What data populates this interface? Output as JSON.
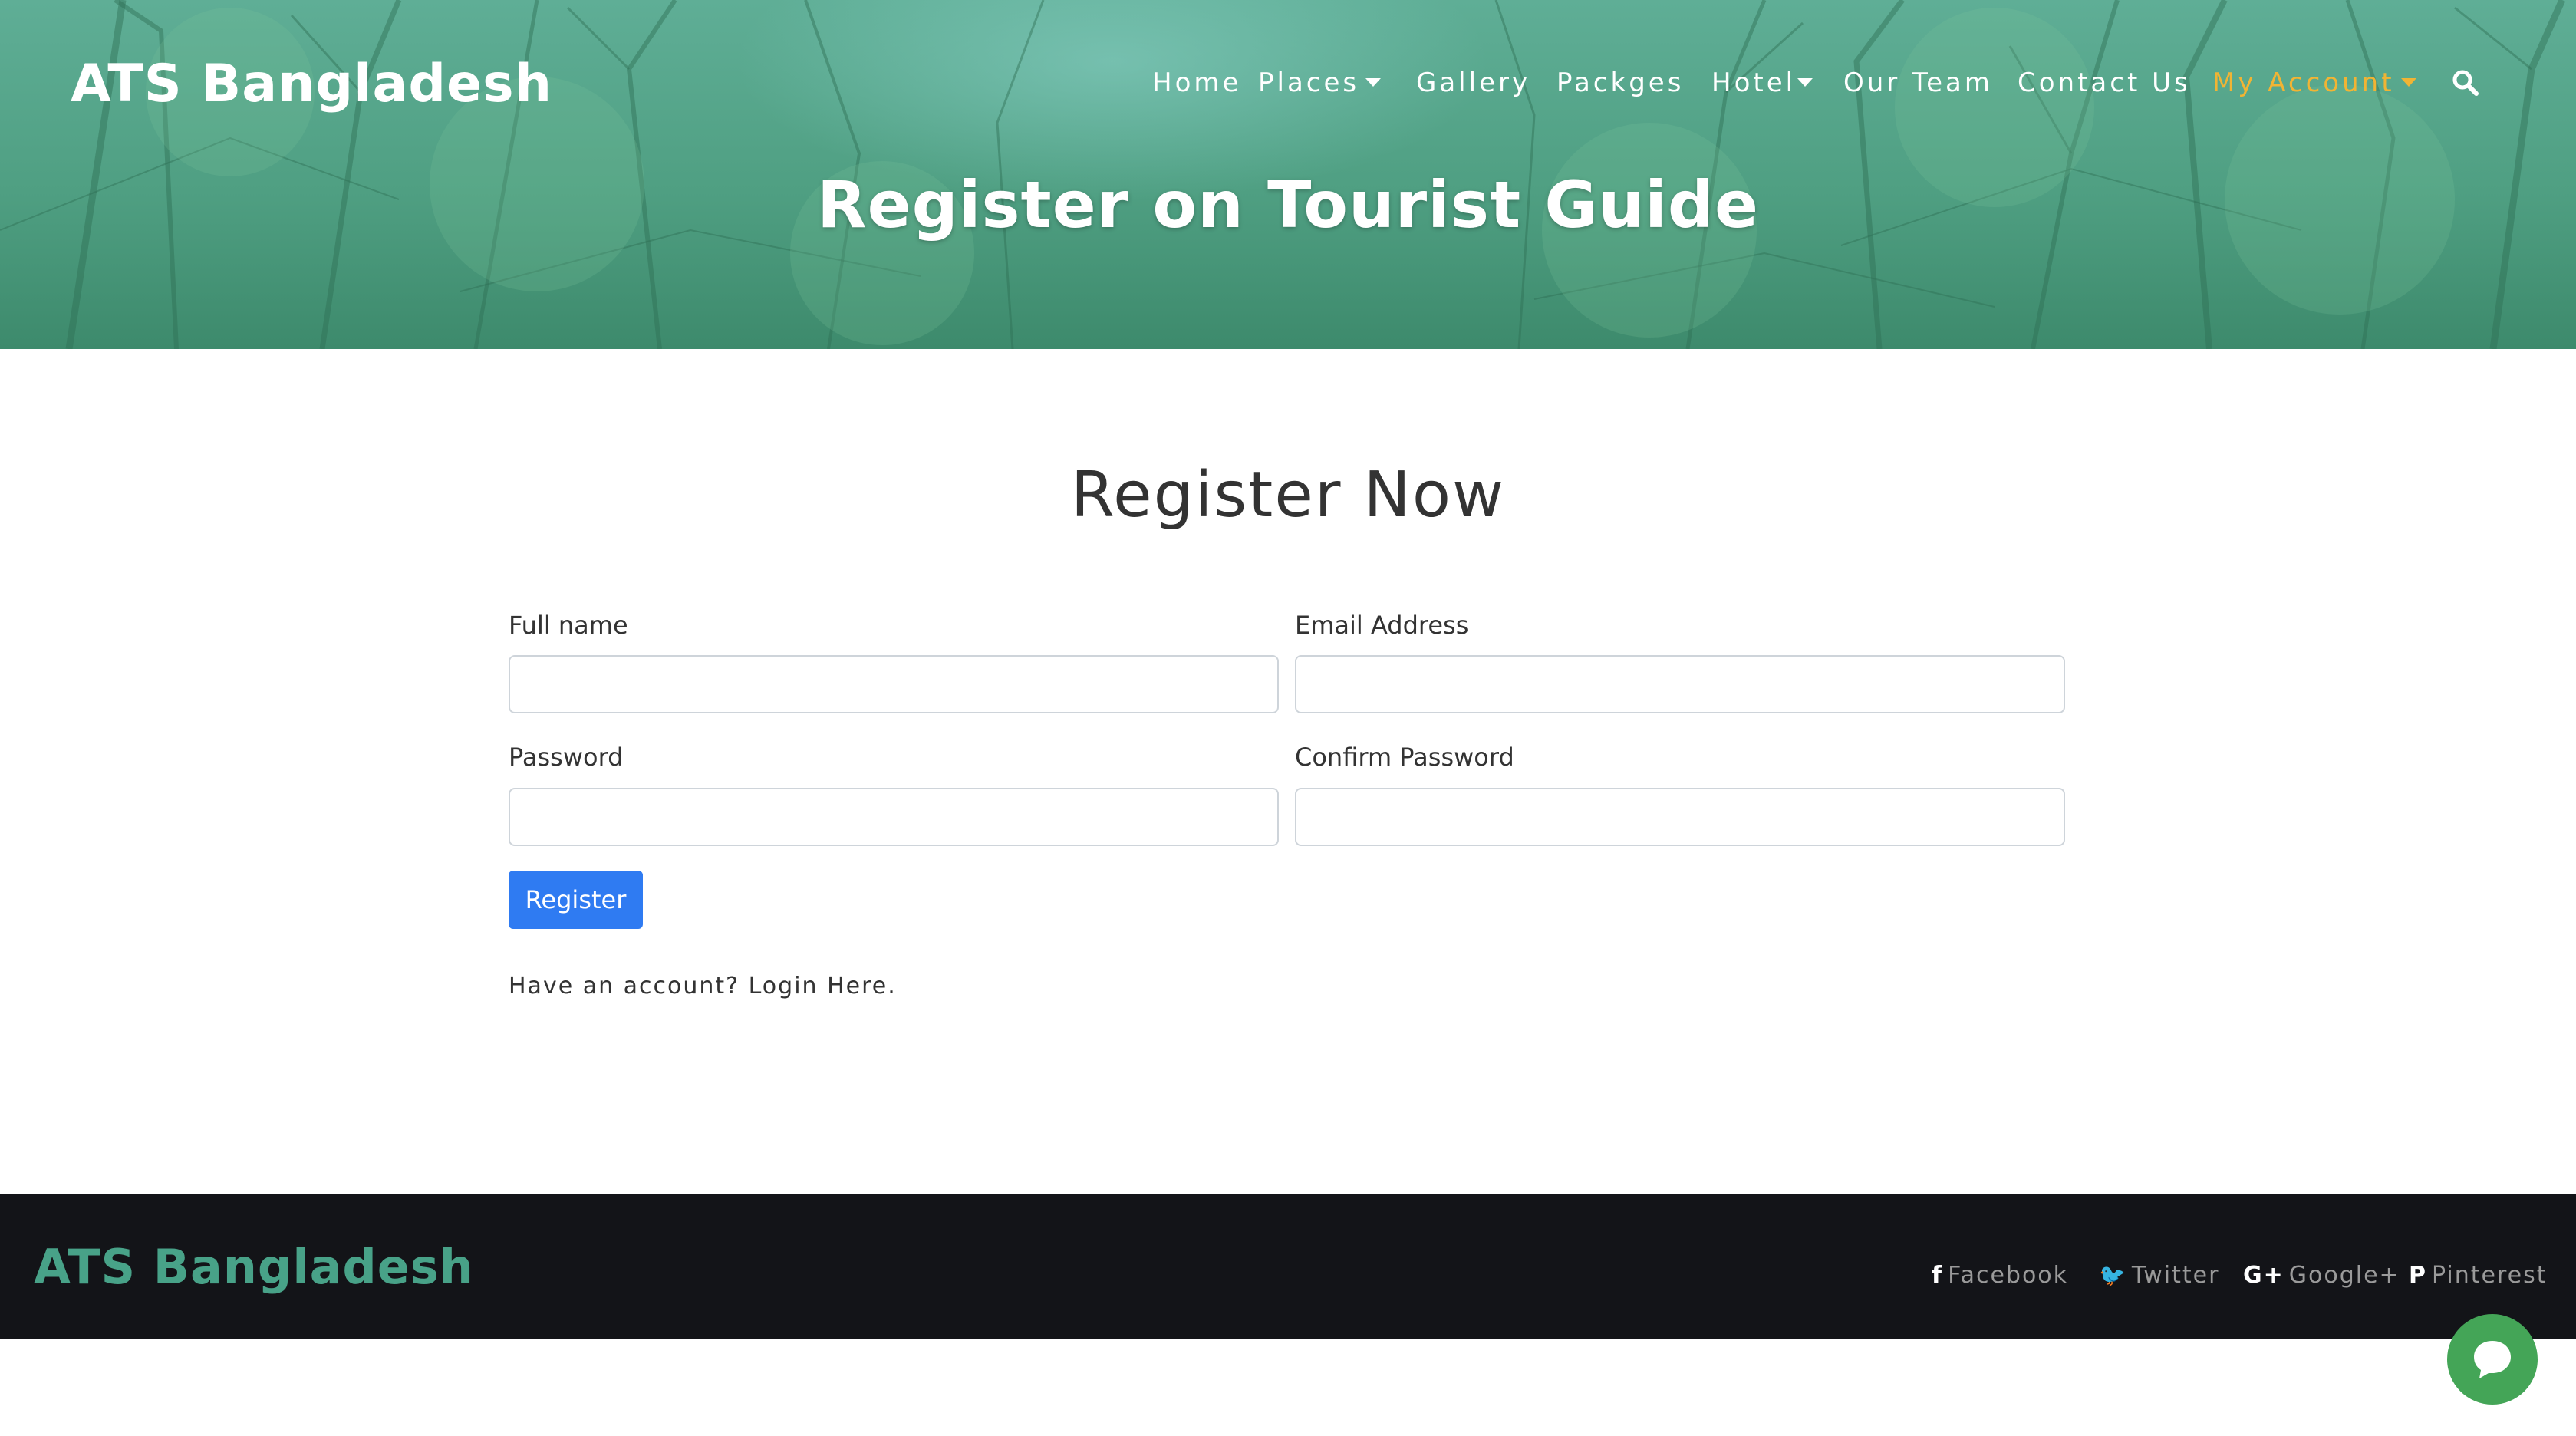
{
  "header": {
    "brand": "ATS Bangladesh",
    "nav": [
      {
        "label": "Home",
        "dropdown": false,
        "active": false
      },
      {
        "label": "Places",
        "dropdown": true,
        "active": false
      },
      {
        "label": "Gallery",
        "dropdown": false,
        "active": false
      },
      {
        "label": "Packges",
        "dropdown": false,
        "active": false
      },
      {
        "label": "Hotel",
        "dropdown": true,
        "active": false
      },
      {
        "label": "Our Team",
        "dropdown": false,
        "active": false
      },
      {
        "label": "Contact Us",
        "dropdown": false,
        "active": false
      },
      {
        "label": "My Account",
        "dropdown": true,
        "active": true
      }
    ],
    "search_icon": "search-icon",
    "hero_title": "Register on Tourist Guide"
  },
  "form": {
    "heading": "Register Now",
    "full_name_label": "Full name",
    "full_name_value": "",
    "email_label": "Email Address",
    "email_value": "",
    "password_label": "Password",
    "password_value": "",
    "confirm_label": "Confirm Password",
    "confirm_value": "",
    "register_label": "Register",
    "have_account_text": "Have an account?",
    "login_link": "Login Here."
  },
  "footer": {
    "brand": "ATS Bangladesh",
    "social": [
      {
        "icon": "facebook-icon",
        "glyph": "f",
        "label": "Facebook"
      },
      {
        "icon": "twitter-icon",
        "glyph": "🐦",
        "label": "Twitter"
      },
      {
        "icon": "google-plus-icon",
        "glyph": "G+",
        "label": "Google+"
      },
      {
        "icon": "pinterest-icon",
        "glyph": "P",
        "label": "Pinterest"
      }
    ]
  },
  "chat": {
    "icon": "chat-icon"
  },
  "colors": {
    "accent": "#f1b434",
    "primary_button": "#2f7bf2",
    "footer_bg": "#131418",
    "footer_brand": "#48a288",
    "chat": "#44a557"
  }
}
